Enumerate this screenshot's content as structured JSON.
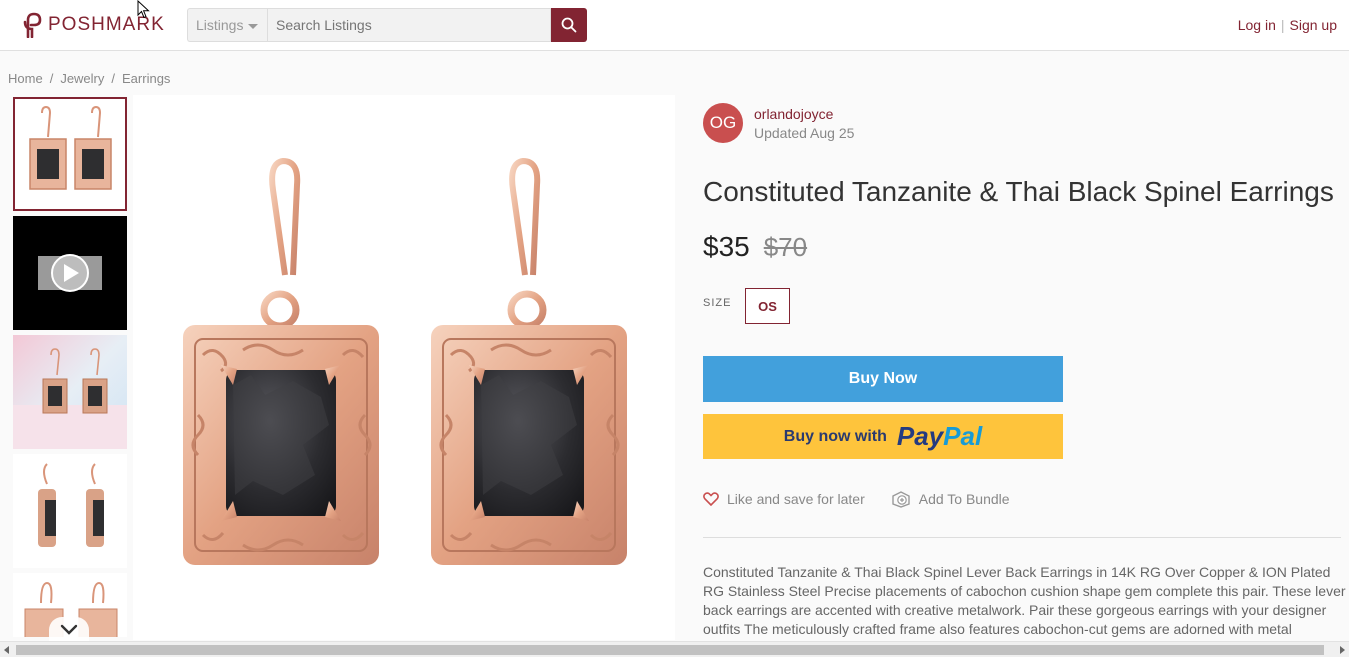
{
  "header": {
    "logo_text": "POSHMARK",
    "search_category": "Listings",
    "search_placeholder": "Search Listings",
    "login_label": "Log in",
    "signup_label": "Sign up",
    "separator": "|"
  },
  "breadcrumb": [
    "Home",
    "/",
    "Jewelry",
    "/",
    "Earrings"
  ],
  "gallery": {
    "thumbnails": [
      "earrings-front",
      "video",
      "earrings-on-box",
      "earrings-side",
      "earrings-hanging"
    ]
  },
  "seller": {
    "initials": "OG",
    "username": "orlandojoyce",
    "updated": "Updated Aug 25"
  },
  "listing": {
    "title": "Constituted Tanzanite & Thai Black Spinel Earrings",
    "price": "$35",
    "original_price": "$70",
    "size_label": "SIZE",
    "size_value": "OS",
    "buy_now_label": "Buy Now",
    "paypal_prefix": "Buy now with",
    "paypal_logo_a": "Pay",
    "paypal_logo_b": "Pal",
    "like_label": "Like and save for later",
    "bundle_label": "Add To Bundle",
    "description": "Constituted Tanzanite & Thai Black Spinel Lever Back Earrings in 14K RG Over Copper & ION Plated RG Stainless Steel Precise placements of cabochon cushion shape gem complete this pair. These lever back earrings are accented with creative metalwork. Pair these gorgeous earrings with your designer outfits The meticulously crafted frame also features cabochon-cut gems are adorned with metal"
  },
  "colors": {
    "brand": "#822432",
    "buy_now": "#42a0dc",
    "paypal_bg": "#fec43c",
    "avatar": "#c94f4f"
  }
}
